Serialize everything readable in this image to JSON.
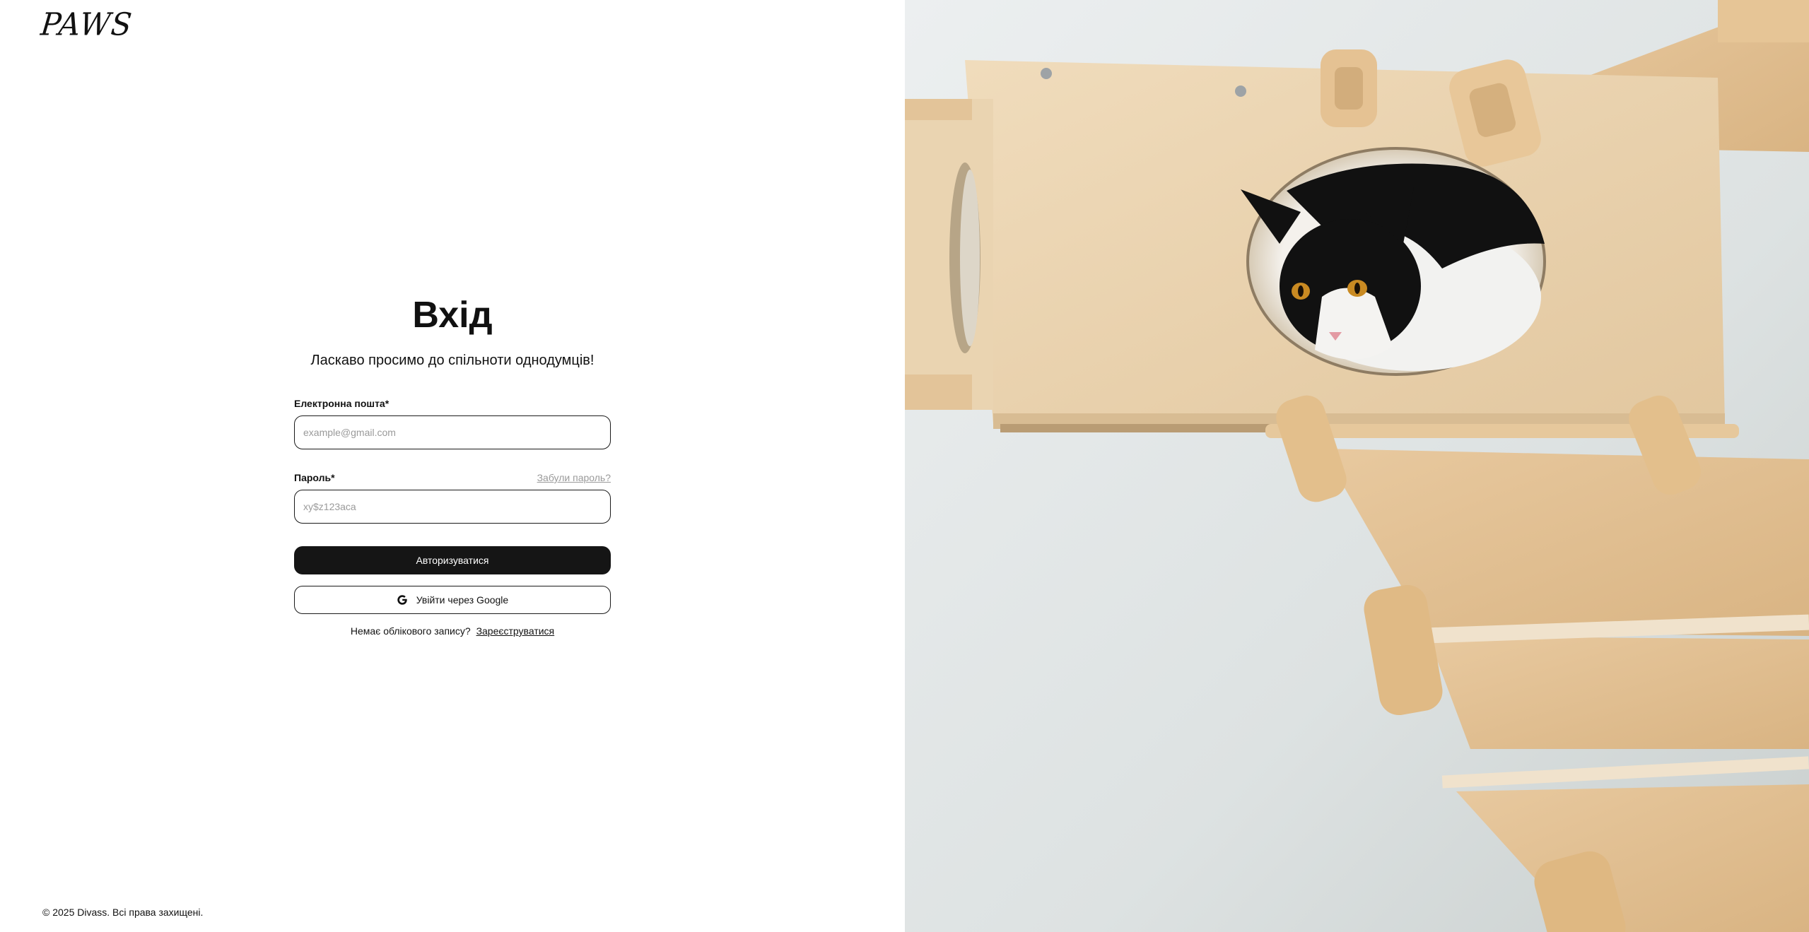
{
  "brand": {
    "logo_text": "PAWS"
  },
  "login": {
    "title": "Вхід",
    "subtitle": "Ласкаво просимо до спільноти однодумців!",
    "email": {
      "label": "Електронна пошта*",
      "placeholder": "example@gmail.com",
      "value": ""
    },
    "password": {
      "label": "Пароль*",
      "placeholder": "xy$z123aca",
      "value": "",
      "forgot_label": "Забули пароль?"
    },
    "submit_label": "Авторизуватися",
    "google_label": "Увійти через Google",
    "no_account_text": "Немає облікового запису?",
    "register_label": "Зареєструватися"
  },
  "footer": {
    "copyright": "© 2025 Divass. Всі права захищені."
  },
  "colors": {
    "primary_button": "#151515",
    "input_border": "#1a1a1a",
    "muted_text": "#9a9a9a",
    "wood": "#e9d3b1"
  },
  "icons": {
    "google": "google-g-icon"
  }
}
